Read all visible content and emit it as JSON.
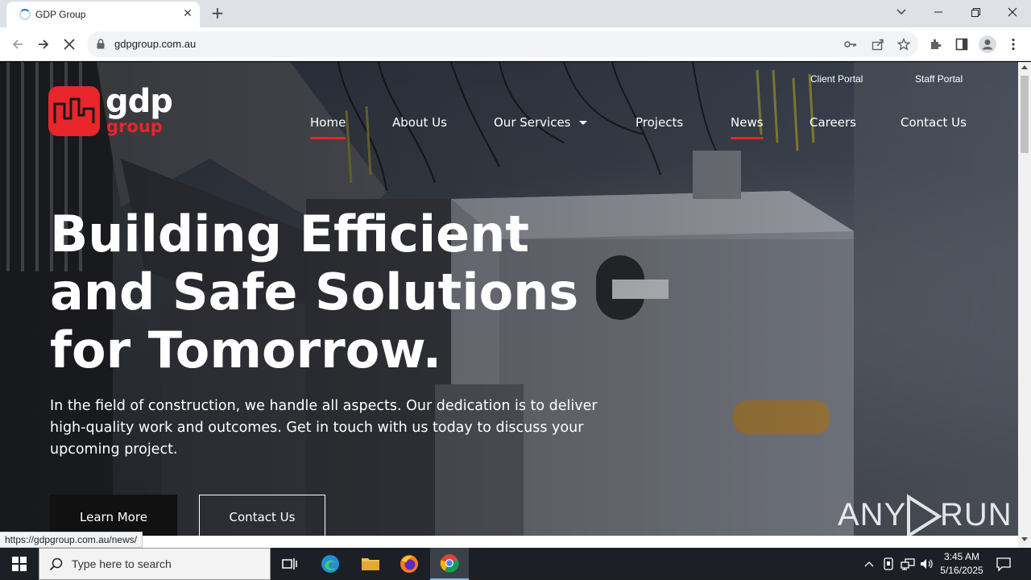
{
  "browser": {
    "tab_title": "GDP Group",
    "url": "gdpgroup.com.au",
    "status_url": "https://gdpgroup.com.au/news/"
  },
  "site": {
    "logo_top": "gdp",
    "logo_bottom": "group",
    "top_links": [
      "Client Portal",
      "Staff Portal"
    ],
    "nav": {
      "home": "Home",
      "about": "About Us",
      "services": "Our Services",
      "projects": "Projects",
      "news": "News",
      "careers": "Careers",
      "contact": "Contact Us"
    },
    "hero": {
      "title_lines": [
        "Building Efficient",
        "and Safe Solutions",
        "for Tomorrow."
      ],
      "text": "In the field of construction, we handle all aspects. Our dedication is to deliver high-quality work and outcomes. Get in touch with us today to discuss your upcoming project.",
      "btn_primary": "Learn More",
      "btn_secondary": "Contact Us"
    },
    "colors": {
      "accent": "#e8262b"
    }
  },
  "watermark": {
    "left": "ANY",
    "right": "RUN"
  },
  "taskbar": {
    "search_placeholder": "Type here to search",
    "time": "3:45 AM",
    "date": "5/16/2025"
  }
}
